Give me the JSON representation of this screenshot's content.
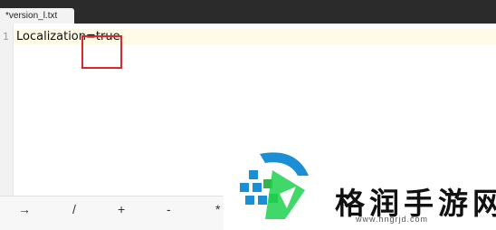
{
  "tabbar": {
    "tab_title": "*version_l.txt"
  },
  "editor": {
    "line_number": "1",
    "line_text": "Localization=true"
  },
  "keybar": {
    "keys": [
      "→",
      "/",
      "+",
      "-",
      "*"
    ]
  },
  "watermark": {
    "ghost_text": "",
    "title": "格润手游网",
    "url": "www.hngrjd.com"
  },
  "colors": {
    "highlight_box": "#d9272e",
    "watermark_green": "#1fd14d",
    "watermark_blue": "#1a8fd6"
  }
}
